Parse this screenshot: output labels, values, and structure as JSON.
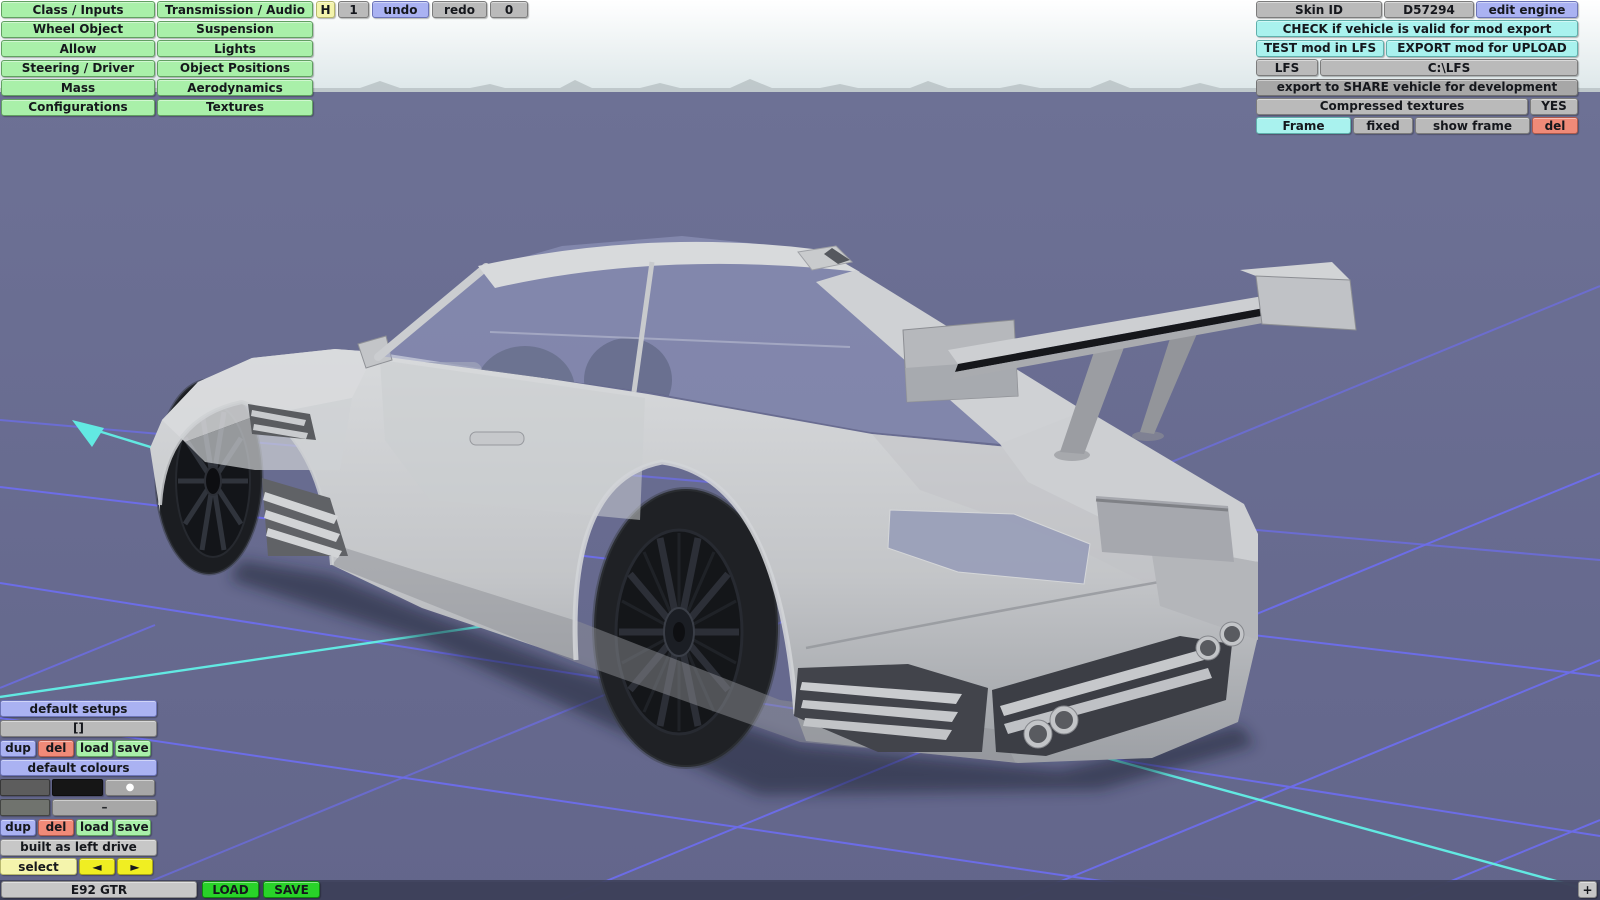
{
  "menu": {
    "items": [
      "Class / Inputs",
      "Transmission / Audio",
      "Wheel Object",
      "Suspension",
      "Allow",
      "Lights",
      "Steering / Driver",
      "Object Positions",
      "Mass",
      "Aerodynamics",
      "Configurations",
      "Textures"
    ]
  },
  "history": {
    "h": "H",
    "step": "1",
    "undo": "undo",
    "redo": "redo",
    "zero": "0"
  },
  "export_panel": {
    "skin_id_label": "Skin ID",
    "skin_id_value": "D57294",
    "edit_engine": "edit engine",
    "check": "CHECK if vehicle is valid for mod export",
    "test": "TEST mod in LFS",
    "export_upload": "EXPORT mod for UPLOAD",
    "lfs": "LFS",
    "lfs_path": "C:\\LFS",
    "share": "export to SHARE vehicle for development",
    "compressed": "Compressed textures",
    "compressed_value": "YES",
    "frame": "Frame",
    "fixed": "fixed",
    "show_frame": "show frame",
    "del_frame": "del"
  },
  "setups_panel": {
    "default_setups": "default setups",
    "setup_name": "[]",
    "dup": "dup",
    "del": "del",
    "load": "load",
    "save": "save",
    "default_colours": "default colours",
    "dot": "●",
    "dash": "–",
    "built": "built as left drive",
    "select": "select",
    "prev": "◄",
    "next": "►"
  },
  "bottom_bar": {
    "vehicle_name": "E92 GTR",
    "load": "LOAD",
    "save": "SAVE",
    "add": "+"
  },
  "viewport": {
    "colors": {
      "sky_top": "#fdfdfd",
      "sky_horizon": "#dfe8ea",
      "ground": "#686c90",
      "grid_line": "#6e6ef8",
      "axis_line": "#62e9e2",
      "bottom_band": "#3e415a",
      "car_body": "#c6c8cb"
    }
  }
}
